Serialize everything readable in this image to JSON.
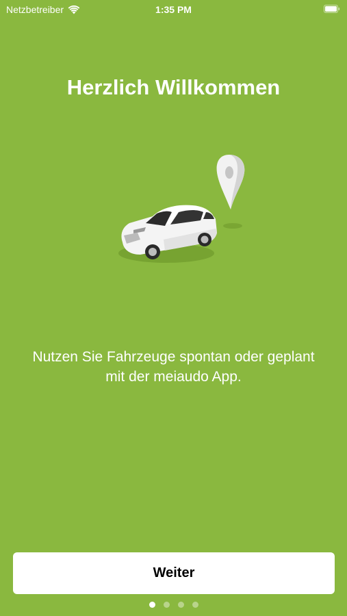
{
  "status_bar": {
    "carrier": "Netzbetreiber",
    "time": "1:35 PM",
    "wifi_icon": "wifi-icon",
    "battery_icon": "battery-icon"
  },
  "onboarding": {
    "title": "Herzlich Willkommen",
    "illustration": "car-with-location-pin-icon",
    "description": "Nutzen Sie Fahrzeuge spontan oder geplant mit der meiaudo App.",
    "next_label": "Weiter",
    "page_count": 4,
    "current_page": 1
  },
  "colors": {
    "background": "#8ab83f",
    "button_background": "#ffffff",
    "text": "#ffffff",
    "button_text": "#000000"
  }
}
